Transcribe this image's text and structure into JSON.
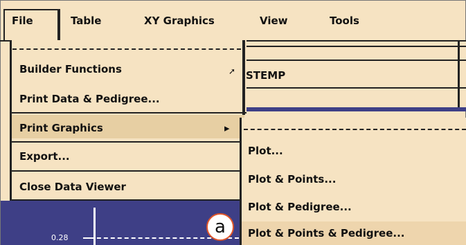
{
  "menubar": {
    "items": [
      "File",
      "Table",
      "XY Graphics",
      "View",
      "Tools"
    ]
  },
  "background_window": {
    "field_text": "STEMP"
  },
  "file_menu": {
    "items": [
      {
        "label": "Builder Functions",
        "has_submenu": true
      },
      {
        "label": "Print Data & Pedigree...",
        "has_submenu": false
      },
      {
        "label": "Print Graphics",
        "has_submenu": true,
        "selected": true
      },
      {
        "label": "Export...",
        "has_submenu": false
      },
      {
        "label": "Close Data Viewer",
        "has_submenu": false
      }
    ]
  },
  "print_graphics_submenu": {
    "items": [
      {
        "label": "Plot..."
      },
      {
        "label": "Plot & Points..."
      },
      {
        "label": "Plot & Pedigree..."
      },
      {
        "label": "Plot & Points & Pedigree...",
        "selected": true
      }
    ]
  },
  "plot": {
    "tick_label": "0.28"
  },
  "annotation": {
    "marker_label": "a"
  },
  "colors": {
    "menu_bg": "#f6e3c2",
    "plot_bg": "#3e3f86",
    "marker_border": "#e0562a"
  }
}
